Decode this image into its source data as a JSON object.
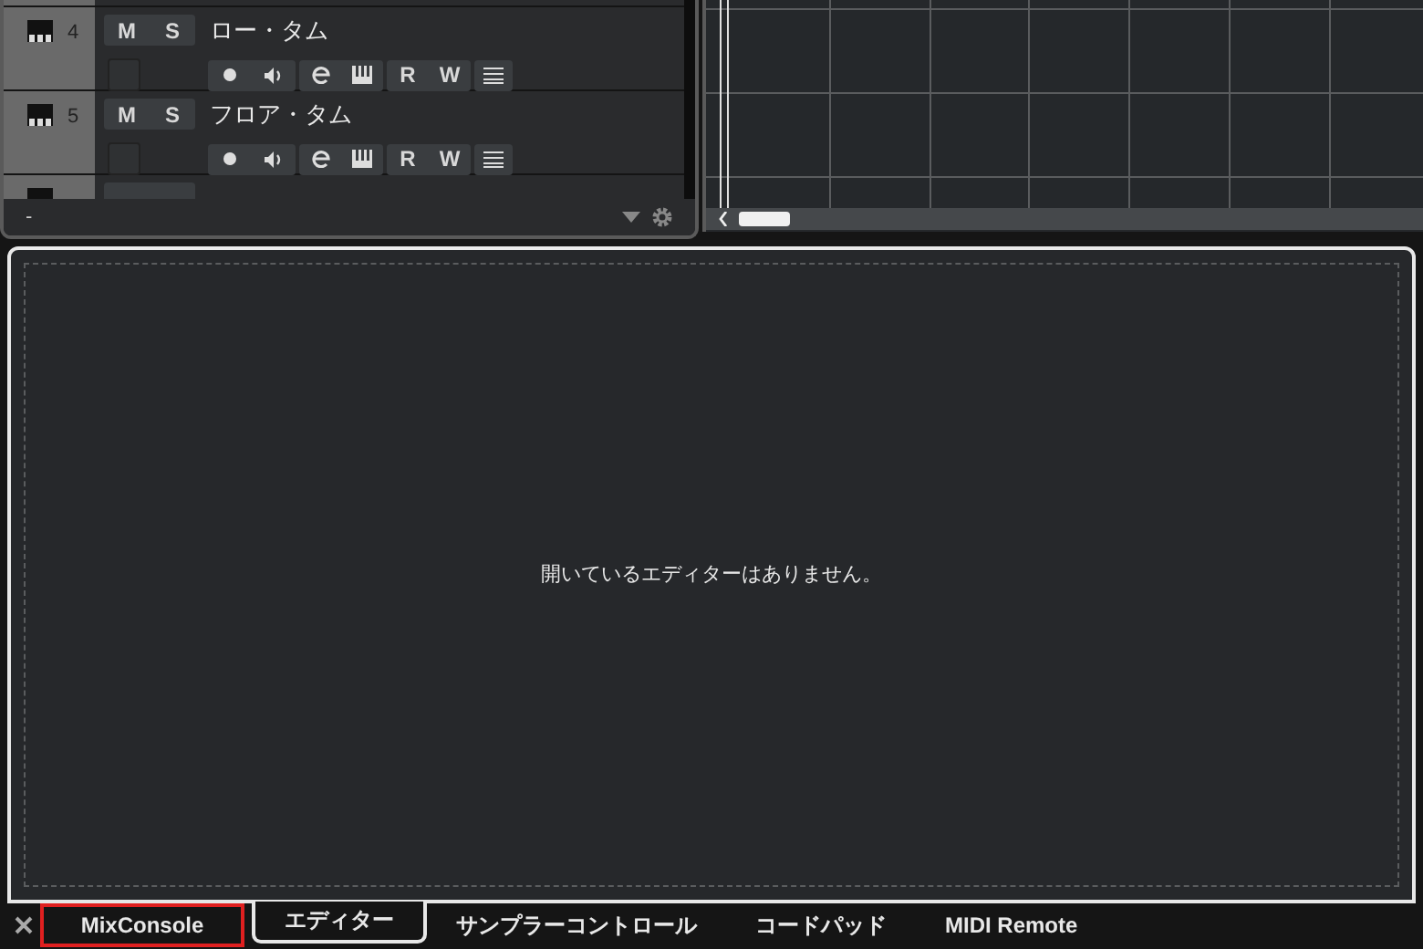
{
  "tracks": [
    {
      "number": "4",
      "name": "ロー・タム",
      "mute_label": "M",
      "solo_label": "S",
      "read_label": "R",
      "write_label": "W"
    },
    {
      "number": "5",
      "name": "フロア・タム",
      "mute_label": "M",
      "solo_label": "S",
      "read_label": "R",
      "write_label": "W"
    }
  ],
  "track_footer": {
    "label": "-"
  },
  "editor_panel": {
    "message": "開いているエディターはありません。"
  },
  "tabs": [
    {
      "label": "MixConsole",
      "selected": false,
      "annotated": true
    },
    {
      "label": "エディター",
      "selected": true,
      "annotated": false
    },
    {
      "label": "サンプラーコントロール",
      "selected": false,
      "annotated": false
    },
    {
      "label": "コードパッド",
      "selected": false,
      "annotated": false
    },
    {
      "label": "MIDI Remote",
      "selected": false,
      "annotated": false
    }
  ]
}
